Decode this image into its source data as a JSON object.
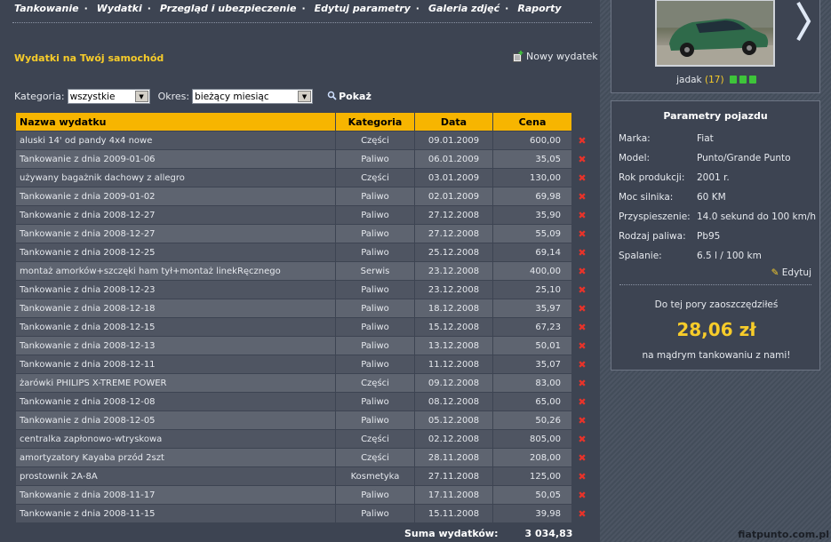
{
  "nav": {
    "items": [
      "Tankowanie",
      "Wydatki",
      "Przegląd i ubezpieczenie",
      "Edytuj parametry",
      "Galeria zdjęć",
      "Raporty"
    ],
    "separator": "·"
  },
  "page": {
    "title": "Wydatki na Twój samochód",
    "new_expense_label": "Nowy wydatek"
  },
  "filters": {
    "category_label": "Kategoria:",
    "category_value": "wszystkie",
    "period_label": "Okres:",
    "period_value": "bieżący miesiąc",
    "show_label": "Pokaż"
  },
  "table": {
    "headers": [
      "Nazwa wydatku",
      "Kategoria",
      "Data",
      "Cena"
    ],
    "rows": [
      {
        "name": "aluski 14' od pandy 4x4 nowe",
        "category": "Części",
        "date": "09.01.2009",
        "price": "600,00"
      },
      {
        "name": "Tankowanie z dnia 2009-01-06",
        "category": "Paliwo",
        "date": "06.01.2009",
        "price": "35,05"
      },
      {
        "name": "używany bagażnik dachowy z allegro",
        "category": "Części",
        "date": "03.01.2009",
        "price": "130,00"
      },
      {
        "name": "Tankowanie z dnia 2009-01-02",
        "category": "Paliwo",
        "date": "02.01.2009",
        "price": "69,98"
      },
      {
        "name": "Tankowanie z dnia 2008-12-27",
        "category": "Paliwo",
        "date": "27.12.2008",
        "price": "35,90"
      },
      {
        "name": "Tankowanie z dnia 2008-12-27",
        "category": "Paliwo",
        "date": "27.12.2008",
        "price": "55,09"
      },
      {
        "name": "Tankowanie z dnia 2008-12-25",
        "category": "Paliwo",
        "date": "25.12.2008",
        "price": "69,14"
      },
      {
        "name": "montaż amorków+szczęki ham tył+montaż linekRęcznego",
        "category": "Serwis",
        "date": "23.12.2008",
        "price": "400,00"
      },
      {
        "name": "Tankowanie z dnia 2008-12-23",
        "category": "Paliwo",
        "date": "23.12.2008",
        "price": "25,10"
      },
      {
        "name": "Tankowanie z dnia 2008-12-18",
        "category": "Paliwo",
        "date": "18.12.2008",
        "price": "35,97"
      },
      {
        "name": "Tankowanie z dnia 2008-12-15",
        "category": "Paliwo",
        "date": "15.12.2008",
        "price": "67,23"
      },
      {
        "name": "Tankowanie z dnia 2008-12-13",
        "category": "Paliwo",
        "date": "13.12.2008",
        "price": "50,01"
      },
      {
        "name": "Tankowanie z dnia 2008-12-11",
        "category": "Paliwo",
        "date": "11.12.2008",
        "price": "35,07"
      },
      {
        "name": "żarówki PHILIPS X-TREME POWER",
        "category": "Części",
        "date": "09.12.2008",
        "price": "83,00"
      },
      {
        "name": "Tankowanie z dnia 2008-12-08",
        "category": "Paliwo",
        "date": "08.12.2008",
        "price": "65,00"
      },
      {
        "name": "Tankowanie z dnia 2008-12-05",
        "category": "Paliwo",
        "date": "05.12.2008",
        "price": "50,26"
      },
      {
        "name": "centralka zapłonowo-wtryskowa",
        "category": "Części",
        "date": "02.12.2008",
        "price": "805,00"
      },
      {
        "name": "amortyzatory Kayaba przód 2szt",
        "category": "Części",
        "date": "28.11.2008",
        "price": "208,00"
      },
      {
        "name": "prostownik 2A-8A",
        "category": "Kosmetyka",
        "date": "27.11.2008",
        "price": "125,00"
      },
      {
        "name": "Tankowanie z dnia 2008-11-17",
        "category": "Paliwo",
        "date": "17.11.2008",
        "price": "50,05"
      },
      {
        "name": "Tankowanie z dnia 2008-11-15",
        "category": "Paliwo",
        "date": "15.11.2008",
        "price": "39,98"
      }
    ],
    "delete_glyph": "✖",
    "sum_label": "Suma wydatków:",
    "sum_value": "3 034,83"
  },
  "user": {
    "name": "jadak",
    "count": "(17)"
  },
  "vehicle": {
    "title": "Parametry pojazdu",
    "params": [
      {
        "label": "Marka:",
        "value": "Fiat"
      },
      {
        "label": "Model:",
        "value": "Punto/Grande Punto"
      },
      {
        "label": "Rok produkcji:",
        "value": "2001 r."
      },
      {
        "label": "Moc silnika:",
        "value": "60 KM"
      },
      {
        "label": "Przyspieszenie:",
        "value": "14.0 sekund do 100 km/h"
      },
      {
        "label": "Rodzaj paliwa:",
        "value": "Pb95"
      },
      {
        "label": "Spalanie:",
        "value": "6.5 l / 100 km"
      }
    ],
    "edit_label": "Edytuj"
  },
  "savings": {
    "label": "Do tej pory zaoszczędziłeś",
    "amount": "28,06 zł",
    "note": "na mądrym tankowaniu z nami!"
  },
  "watermark": "fiatpunto.com.pl",
  "colors": {
    "accent_yellow": "#f7b500",
    "amount_yellow": "#f7cc2a",
    "delete_red": "#e8332a",
    "background": "#3d4452"
  }
}
